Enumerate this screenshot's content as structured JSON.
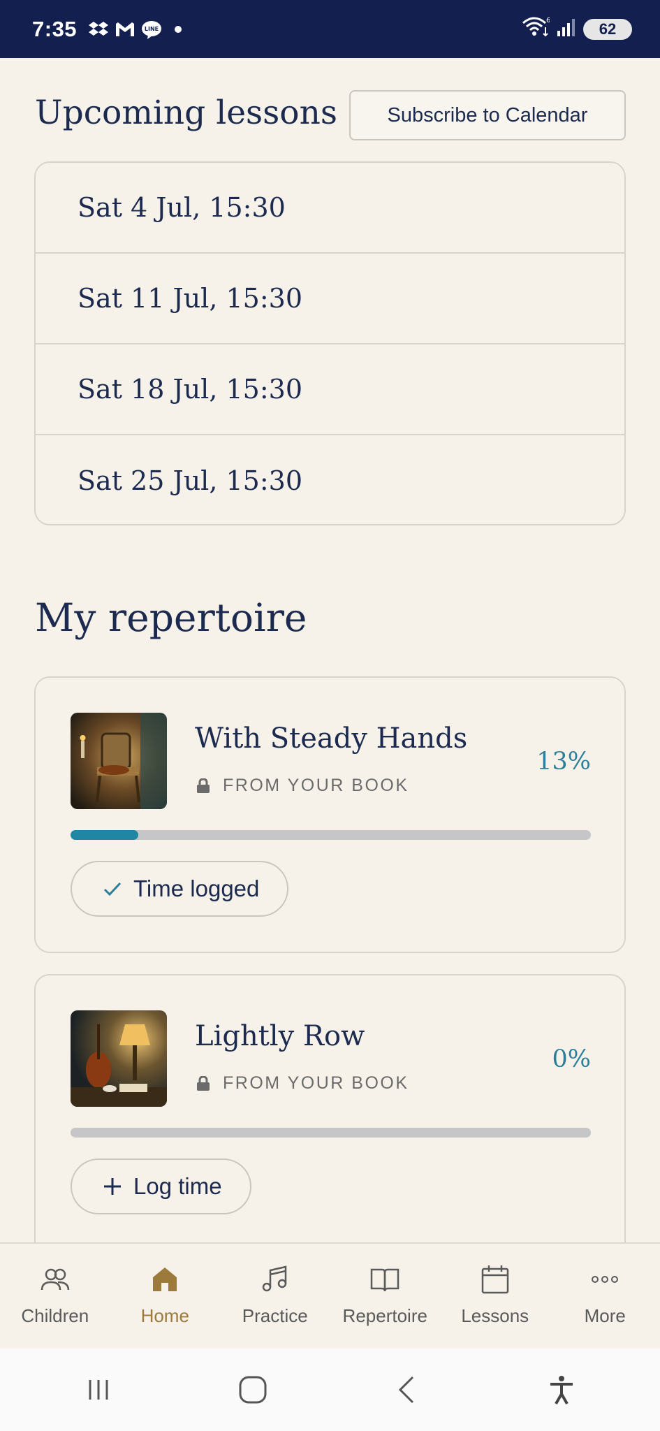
{
  "status_bar": {
    "time": "7:35",
    "battery": "62",
    "left_icons": [
      "dropbox-icon",
      "gmail-icon",
      "line-icon",
      "dot-icon"
    ],
    "right_icons": [
      "wifi-icon",
      "signal-icon",
      "battery-icon"
    ]
  },
  "upcoming": {
    "title": "Upcoming lessons",
    "subscribe_label": "Subscribe to Calendar",
    "lessons": [
      "Sat 4 Jul, 15:30",
      "Sat 11 Jul, 15:30",
      "Sat 18 Jul, 15:30",
      "Sat 25 Jul, 15:30"
    ]
  },
  "repertoire": {
    "title": "My repertoire",
    "pieces": [
      {
        "name": "With Steady Hands",
        "source": "FROM YOUR BOOK",
        "percent": "13%",
        "progress": 0.13,
        "action_label": "Time logged",
        "action_icon": "check-icon"
      },
      {
        "name": "Lightly Row",
        "source": "FROM YOUR BOOK",
        "percent": "0%",
        "progress": 0.0,
        "action_label": "Log time",
        "action_icon": "plus-icon"
      }
    ]
  },
  "bottom_nav": {
    "items": [
      {
        "label": "Children",
        "icon": "people-icon",
        "active": false
      },
      {
        "label": "Home",
        "icon": "home-icon",
        "active": true
      },
      {
        "label": "Practice",
        "icon": "music-note-icon",
        "active": false
      },
      {
        "label": "Repertoire",
        "icon": "book-icon",
        "active": false
      },
      {
        "label": "Lessons",
        "icon": "calendar-icon",
        "active": false
      },
      {
        "label": "More",
        "icon": "more-icon",
        "active": false
      }
    ]
  },
  "colors": {
    "background": "#f6f2e9",
    "status_bar": "#131f4f",
    "primary_text": "#1b2a4e",
    "accent_teal": "#2c7f9a",
    "progress_fill": "#1f86a3",
    "active_nav": "#9b7a3b"
  }
}
